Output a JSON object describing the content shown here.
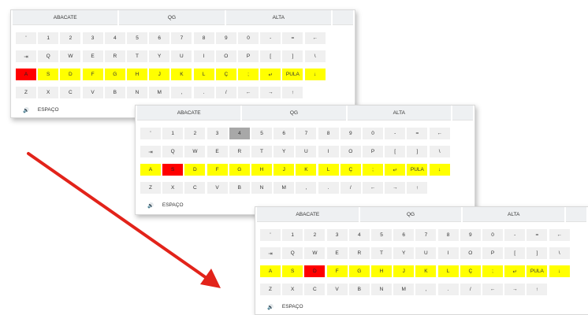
{
  "tabs": [
    "ABACATE",
    "QG",
    "ALTA"
  ],
  "keyboard": {
    "rows": [
      [
        "'",
        "1",
        "2",
        "3",
        "4",
        "5",
        "6",
        "7",
        "8",
        "9",
        "0",
        "-",
        "=",
        "←"
      ],
      [
        "⇥",
        "Q",
        "W",
        "E",
        "R",
        "T",
        "Y",
        "U",
        "I",
        "O",
        "P",
        "[",
        "]",
        "\\"
      ],
      [
        "A",
        "S",
        "D",
        "F",
        "G",
        "H",
        "J",
        "K",
        "L",
        "Ç",
        ";",
        "↵",
        "PULA",
        "↓"
      ],
      [
        "Z",
        "X",
        "C",
        "V",
        "B",
        "N",
        "M",
        ",",
        ".",
        "/",
        "←",
        "→",
        "↑"
      ],
      [
        "🔊",
        "ESPAÇO"
      ]
    ]
  },
  "states": [
    {
      "name": "state-1",
      "selected_key": "A",
      "pressed_key": ""
    },
    {
      "name": "state-2",
      "selected_key": "S",
      "pressed_key": "4"
    },
    {
      "name": "state-3",
      "selected_key": "D",
      "pressed_key": ""
    }
  ],
  "colors": {
    "highlight": "#ffff00",
    "selected": "#ff0000",
    "pressed": "#a8a8a8",
    "key": "#f0f0f0",
    "arrow": "#e2231a"
  },
  "icons": {
    "arrow": "red-diagonal-arrow",
    "speaker": "speaker-icon"
  }
}
